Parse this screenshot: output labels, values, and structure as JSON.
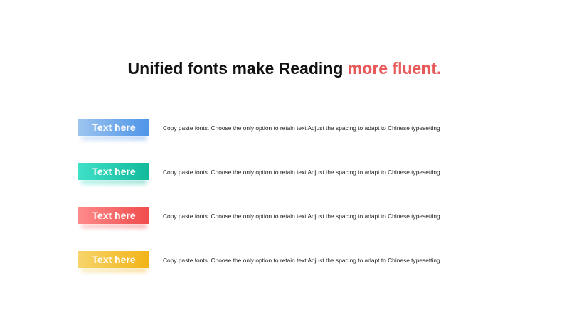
{
  "title": {
    "main": "Unified fonts make Reading ",
    "accent": "more fluent."
  },
  "rows": [
    {
      "tag": "Text here",
      "text": "Copy paste fonts. Choose the only option to retain text Adjust the spacing to adapt to Chinese typesetting",
      "color_from": "#9cc4f0",
      "color_to": "#4e95e8"
    },
    {
      "tag": "Text here",
      "text": "Copy paste fonts. Choose the only option to retain text Adjust the spacing to adapt to Chinese typesetting",
      "color_from": "#3fe0c8",
      "color_to": "#12b99a"
    },
    {
      "tag": "Text here",
      "text": "Copy paste fonts. Choose the only option to retain text Adjust the spacing to adapt to Chinese typesetting",
      "color_from": "#ff8a8a",
      "color_to": "#f04c4c"
    },
    {
      "tag": "Text here",
      "text": "Copy paste fonts. Choose the only option to retain text Adjust the spacing to adapt to Chinese typesetting",
      "color_from": "#f7d46a",
      "color_to": "#f2b417"
    }
  ],
  "colors": {
    "title": "#111111",
    "accent": "#e85a5a"
  }
}
